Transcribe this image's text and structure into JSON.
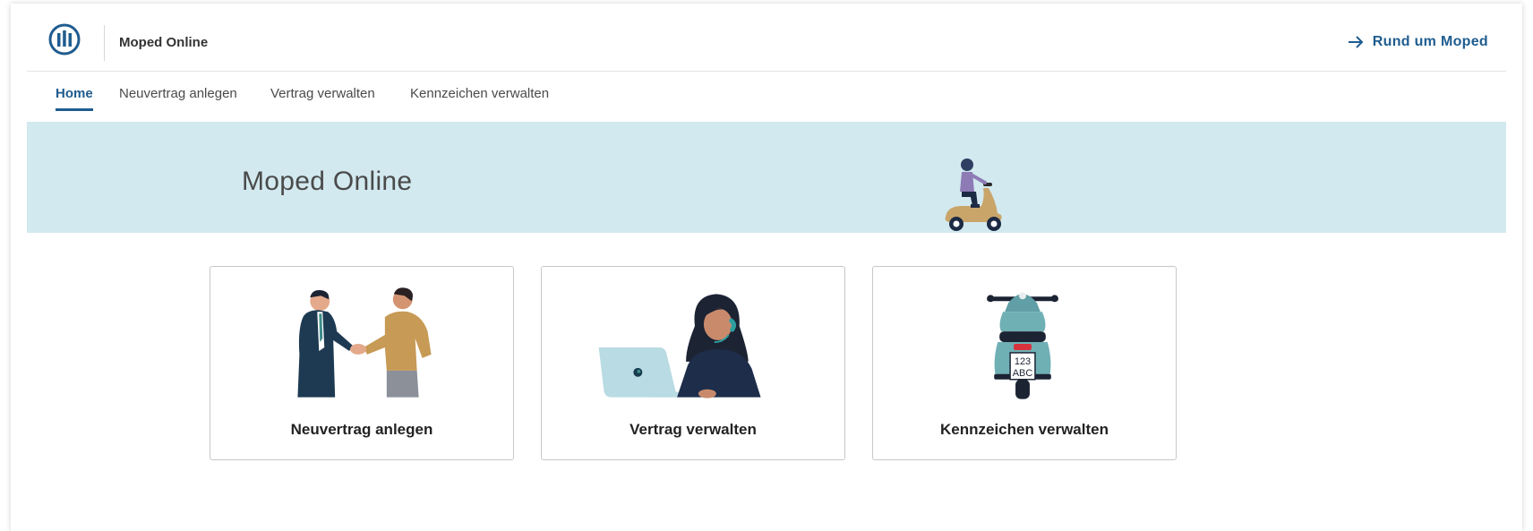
{
  "header": {
    "app_title": "Moped Online",
    "rund_link": "Rund um Moped"
  },
  "nav": {
    "items": [
      {
        "label": "Home",
        "active": true
      },
      {
        "label": "Neuvertrag anlegen",
        "active": false
      },
      {
        "label": "Vertrag verwalten",
        "active": false
      },
      {
        "label": "Kennzeichen verwalten",
        "active": false
      }
    ]
  },
  "banner": {
    "title": "Moped Online"
  },
  "cards": [
    {
      "label": "Neuvertrag anlegen",
      "illustration": "handshake-illustration"
    },
    {
      "label": "Vertrag verwalten",
      "illustration": "support-agent-illustration"
    },
    {
      "label": "Kennzeichen verwalten",
      "illustration": "scooter-plate-illustration"
    }
  ],
  "plate": {
    "line1": "123",
    "line2": "ABC"
  },
  "colors": {
    "brand": "#1f5c8f",
    "banner_bg": "#d2e9ef",
    "card_border": "#c8c8c8"
  }
}
